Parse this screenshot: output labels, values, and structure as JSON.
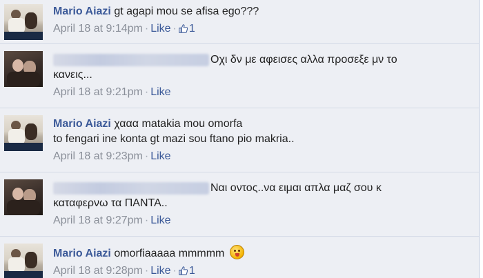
{
  "comments": [
    {
      "author": "Mario Aiazi",
      "author_blurred": false,
      "lines": [
        "gt agapi mou se afisa ego???"
      ],
      "time": "April 18 at 9:14pm",
      "like_label": "Like",
      "like_count": "1"
    },
    {
      "author": "",
      "author_blurred": true,
      "lines": [
        "Οχι δν με αφεισες αλλα προσεξε μν το",
        "κανεις..."
      ],
      "time": "April 18 at 9:21pm",
      "like_label": "Like"
    },
    {
      "author": "Mario Aiazi",
      "author_blurred": false,
      "lines": [
        "χααα matakia mou omorfa",
        "to fengari ine konta gt mazi sou ftano pio makria.."
      ],
      "time": "April 18 at 9:23pm",
      "like_label": "Like"
    },
    {
      "author": "",
      "author_blurred": true,
      "lines": [
        "Ναι οντος..να ειμαι απλα μαζ σου κ",
        "καταφερνω τα ΠΑΝΤΑ.."
      ],
      "time": "April 18 at 9:27pm",
      "like_label": "Like"
    },
    {
      "author": "Mario Aiazi",
      "author_blurred": false,
      "lines": [
        "omorfiaaaaa mmmmm"
      ],
      "time": "April 18 at 9:28pm",
      "like_label": "Like",
      "like_count": "1",
      "emoticon": "smiley-icon"
    }
  ],
  "colors": {
    "background": "#edeff4",
    "link": "#3b5998",
    "meta_text": "#8a8f99"
  }
}
